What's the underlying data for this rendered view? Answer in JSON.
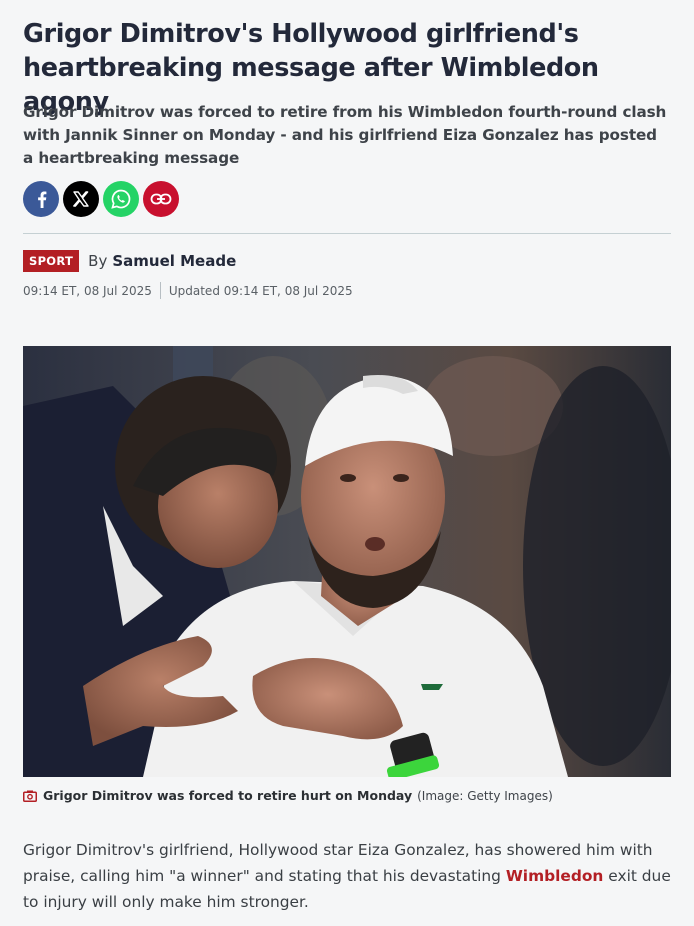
{
  "article": {
    "headline": "Grigor Dimitrov's Hollywood girlfriend's heartbreaking message after Wimbledon agony",
    "standfirst": "Grigor Dimitrov was forced to retire from his Wimbledon fourth-round clash with Jannik Sinner on Monday - and his girlfriend Eiza Gonzalez has posted a heartbreaking message"
  },
  "share": [
    {
      "icon": "facebook-icon",
      "color": "#3b5998"
    },
    {
      "icon": "x-icon",
      "color": "#000000"
    },
    {
      "icon": "whatsapp-icon",
      "color": "#25d366"
    },
    {
      "icon": "link-icon",
      "color": "#c8102e"
    }
  ],
  "byline": {
    "section": "SPORT",
    "by": "By",
    "author": "Samuel Meade",
    "published": "09:14 ET, 08 Jul 2025",
    "updated": "Updated 09:14 ET, 08 Jul 2025"
  },
  "image": {
    "caption": "Grigor Dimitrov was forced to retire hurt on Monday",
    "credit": "(Image: Getty Images)"
  },
  "body": {
    "p1_before": "Grigor Dimitrov's girlfriend, Hollywood star Eiza Gonzalez, has showered him with praise, calling him \"a winner\" and stating that his devastating ",
    "p1_link": "Wimbledon",
    "p1_after": " exit due to injury will only make him stronger."
  },
  "colors": {
    "accent": "#b31f24",
    "headline": "#23293a",
    "background": "#f5f6f7"
  }
}
